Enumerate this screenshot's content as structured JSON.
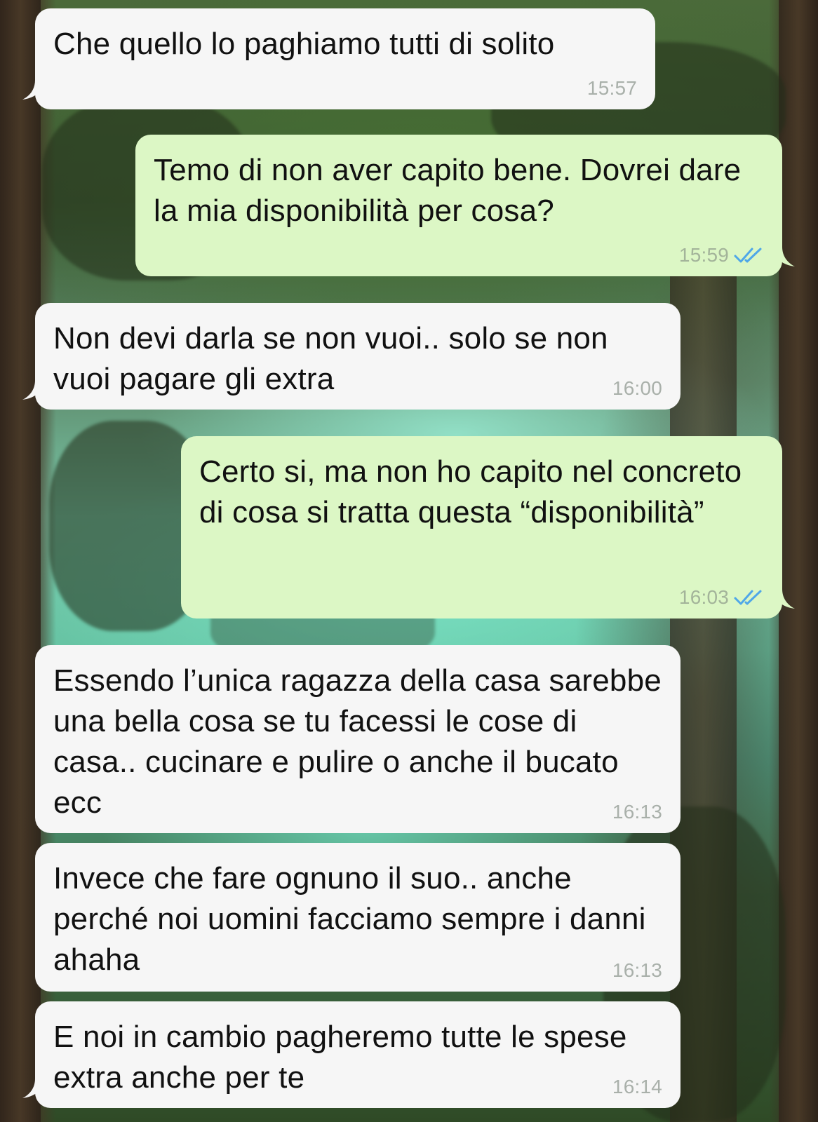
{
  "messages": [
    {
      "direction": "incoming",
      "text": "Che quello lo paghiamo tutti di solito",
      "time": "15:57"
    },
    {
      "direction": "outgoing",
      "text": "Temo di non aver capito bene. Dovrei dare la mia disponibilità per cosa?",
      "time": "15:59",
      "status_icon": "double-check-read-icon"
    },
    {
      "direction": "incoming",
      "text": "Non devi darla se non vuoi.. solo se non vuoi pagare gli extra",
      "time": "16:00"
    },
    {
      "direction": "outgoing",
      "text": "Certo si, ma non ho capito nel concreto di cosa si tratta questa “disponibilità”",
      "time": "16:03",
      "status_icon": "double-check-read-icon"
    },
    {
      "direction": "incoming",
      "text": "Essendo l’unica ragazza della casa sarebbe una bella cosa se tu facessi le cose di casa.. cucinare e pulire o anche il bucato ecc",
      "time": "16:13"
    },
    {
      "direction": "incoming",
      "text": "Invece che fare ognuno il suo.. anche perché noi uomini facciamo sempre i danni ahaha",
      "time": "16:13"
    },
    {
      "direction": "incoming",
      "text": "E noi in cambio pagheremo tutte le spese extra anche per te",
      "time": "16:14"
    }
  ],
  "colors": {
    "incoming_bubble": "#f6f6f6",
    "outgoing_bubble": "#dcf7c5",
    "read_ticks": "#4fa7e8",
    "timestamp": "#a9b0aa"
  }
}
